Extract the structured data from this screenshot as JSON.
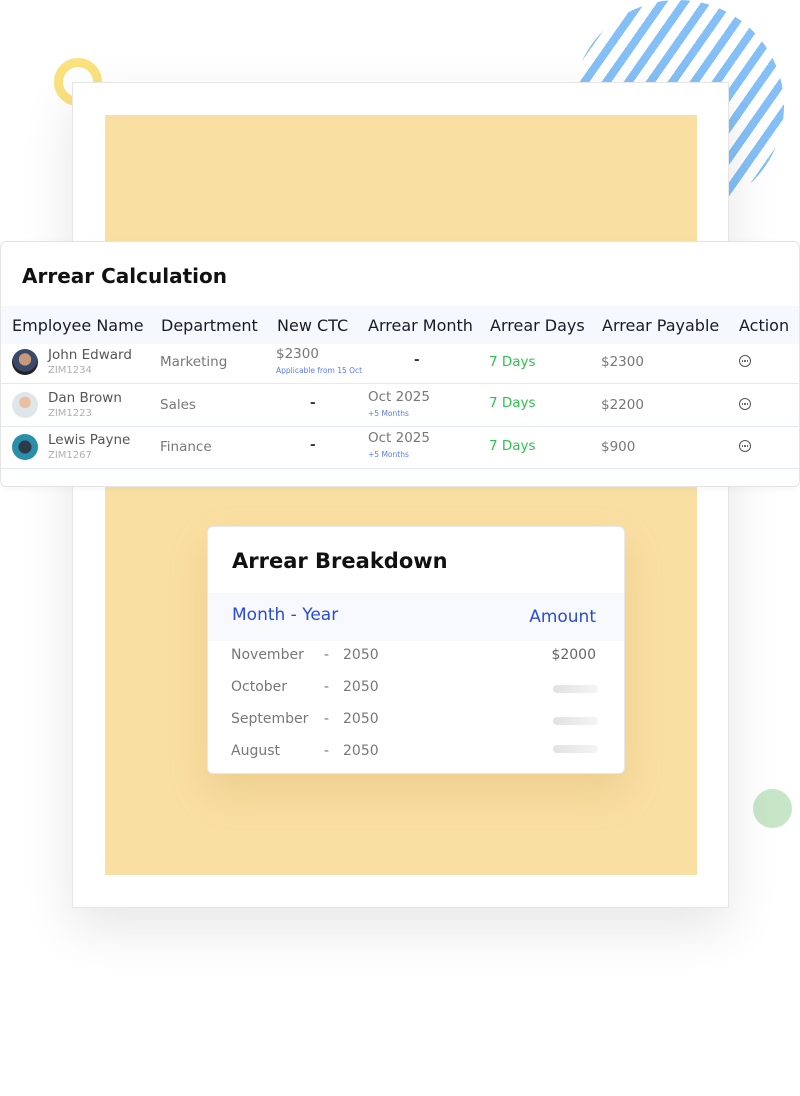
{
  "calculation": {
    "title": "Arrear Calculation",
    "columns": [
      "Employee Name",
      "Department",
      "New CTC",
      "Arrear Month",
      "Arrear Days",
      "Arrear Payable",
      "Action"
    ],
    "rows": [
      {
        "name": "John Edward",
        "id": "ZIM1234",
        "department": "Marketing",
        "new_ctc": "$2300",
        "new_ctc_note": "Applicable from 15 Oct",
        "arrear_month": "-",
        "arrear_month_note": "",
        "arrear_days": "7 Days",
        "arrear_payable": "$2300",
        "action_icon": "more-options-icon"
      },
      {
        "name": "Dan Brown",
        "id": "ZIM1223",
        "department": "Sales",
        "new_ctc": "-",
        "new_ctc_note": "",
        "arrear_month": "Oct 2025",
        "arrear_month_note": "+5 Months",
        "arrear_days": "7 Days",
        "arrear_payable": "$2200",
        "action_icon": "more-options-icon"
      },
      {
        "name": "Lewis Payne",
        "id": "ZIM1267",
        "department": "Finance",
        "new_ctc": "-",
        "new_ctc_note": "",
        "arrear_month": "Oct 2025",
        "arrear_month_note": "+5 Months",
        "arrear_days": "7 Days",
        "arrear_payable": "$900",
        "action_icon": "more-options-icon"
      }
    ]
  },
  "breakdown": {
    "title": "Arrear Breakdown",
    "header_month_year": "Month - Year",
    "header_amount": "Amount",
    "rows": [
      {
        "month": "November",
        "sep": "-",
        "year": "2050",
        "amount": "$2000"
      },
      {
        "month": "October",
        "sep": "-",
        "year": "2050",
        "amount": null
      },
      {
        "month": "September",
        "sep": "-",
        "year": "2050",
        "amount": null
      },
      {
        "month": "August",
        "sep": "-",
        "year": "2050",
        "amount": null
      }
    ]
  },
  "colors": {
    "accent_blue": "#2a4bd6",
    "days_green": "#2fbf4f",
    "panel_yellow": "#fadfa3"
  }
}
